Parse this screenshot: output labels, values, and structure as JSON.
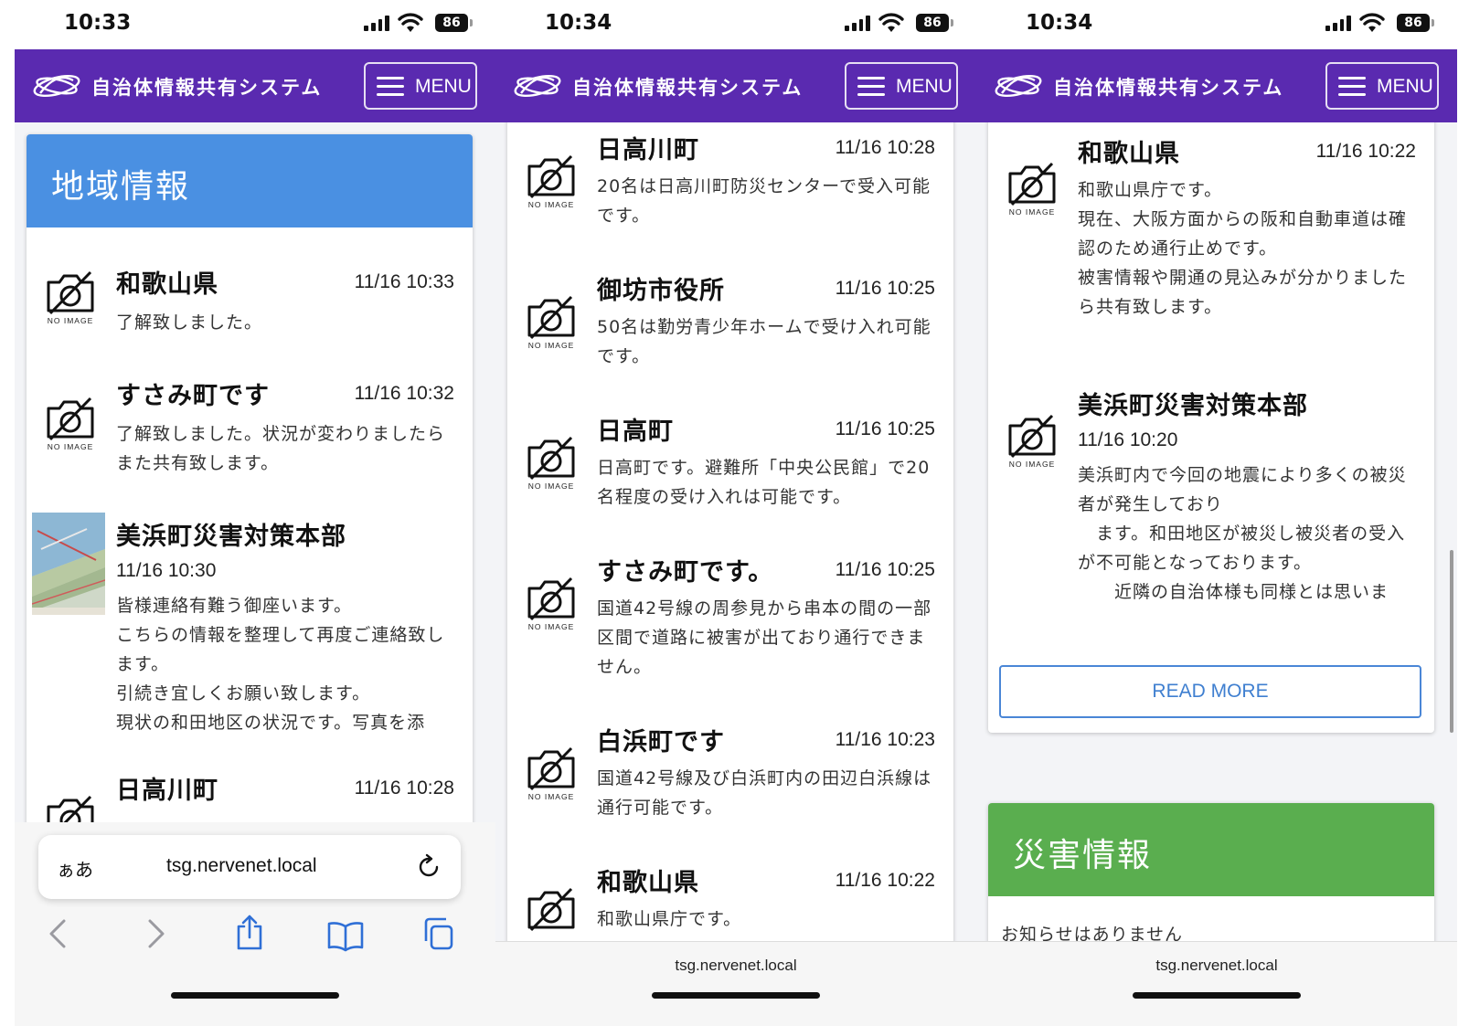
{
  "status_bar": {
    "times": [
      "10:33",
      "10:34",
      "10:34"
    ],
    "battery": "86"
  },
  "navbar": {
    "brand": "自治体情報共有システム",
    "menu_label": "MENU",
    "color": "#5a2ab0"
  },
  "no_image_label": "NO IMAGE",
  "region_header": {
    "title": "地域情報",
    "color": "#4a90e2"
  },
  "disaster_header": {
    "title": "災害情報",
    "color": "#5aae4f",
    "empty": "お知らせはありません"
  },
  "read_more_label": "READ MORE",
  "browser": {
    "aa": "ぁあ",
    "url": "tsg.nervenet.local"
  },
  "screen1_items": [
    {
      "title": "和歌山県",
      "time": "11/16 10:33",
      "body": "了解致しました。"
    },
    {
      "title": "すさみ町です",
      "time": "11/16 10:32",
      "body": "了解致しました。状況が変わりましたらまた共有致します。"
    },
    {
      "title": "美浜町災害対策本部",
      "time": "11/16 10:30",
      "body": "皆様連絡有難う御座います。\nこちらの情報を整理して再度ご連絡致します。\n引続き宜しくお願い致します。\n現状の和田地区の状況です。写真を添"
    },
    {
      "title": "日高川町",
      "time": "11/16 10:28"
    }
  ],
  "screen2_items": [
    {
      "title": "日高川町",
      "time": "11/16 10:28",
      "body": "20名は日高川町防災センターで受入可能です。"
    },
    {
      "title": "御坊市役所",
      "time": "11/16 10:25",
      "body": "50名は勤労青少年ホームで受け入れ可能です。"
    },
    {
      "title": "日高町",
      "time": "11/16 10:25",
      "body": "日高町です。避難所「中央公民館」で20名程度の受け入れは可能です。"
    },
    {
      "title": "すさみ町です。",
      "time": "11/16 10:25",
      "body": "国道42号線の周参見から串本の間の一部区間で道路に被害が出ており通行できません。"
    },
    {
      "title": "白浜町です",
      "time": "11/16 10:23",
      "body": "国道42号線及び白浜町内の田辺白浜線は通行可能です。"
    },
    {
      "title": "和歌山県",
      "time": "11/16 10:22",
      "body": "和歌山県庁です。"
    }
  ],
  "screen3_items": [
    {
      "title": "和歌山県",
      "time": "11/16 10:22",
      "body": "和歌山県庁です。\n現在、大阪方面からの阪和自動車道は確認のため通行止めです。\n被害情報や開通の見込みが分かりましたら共有致します。"
    },
    {
      "title": "美浜町災害対策本部",
      "time": "11/16 10:20",
      "body": "美浜町内で今回の地震により多くの被災者が発生しており\n　ます。和田地区が被災し被災者の受入が不可能となっております。\n　　近隣の自治体様も同様とは思いま"
    }
  ]
}
